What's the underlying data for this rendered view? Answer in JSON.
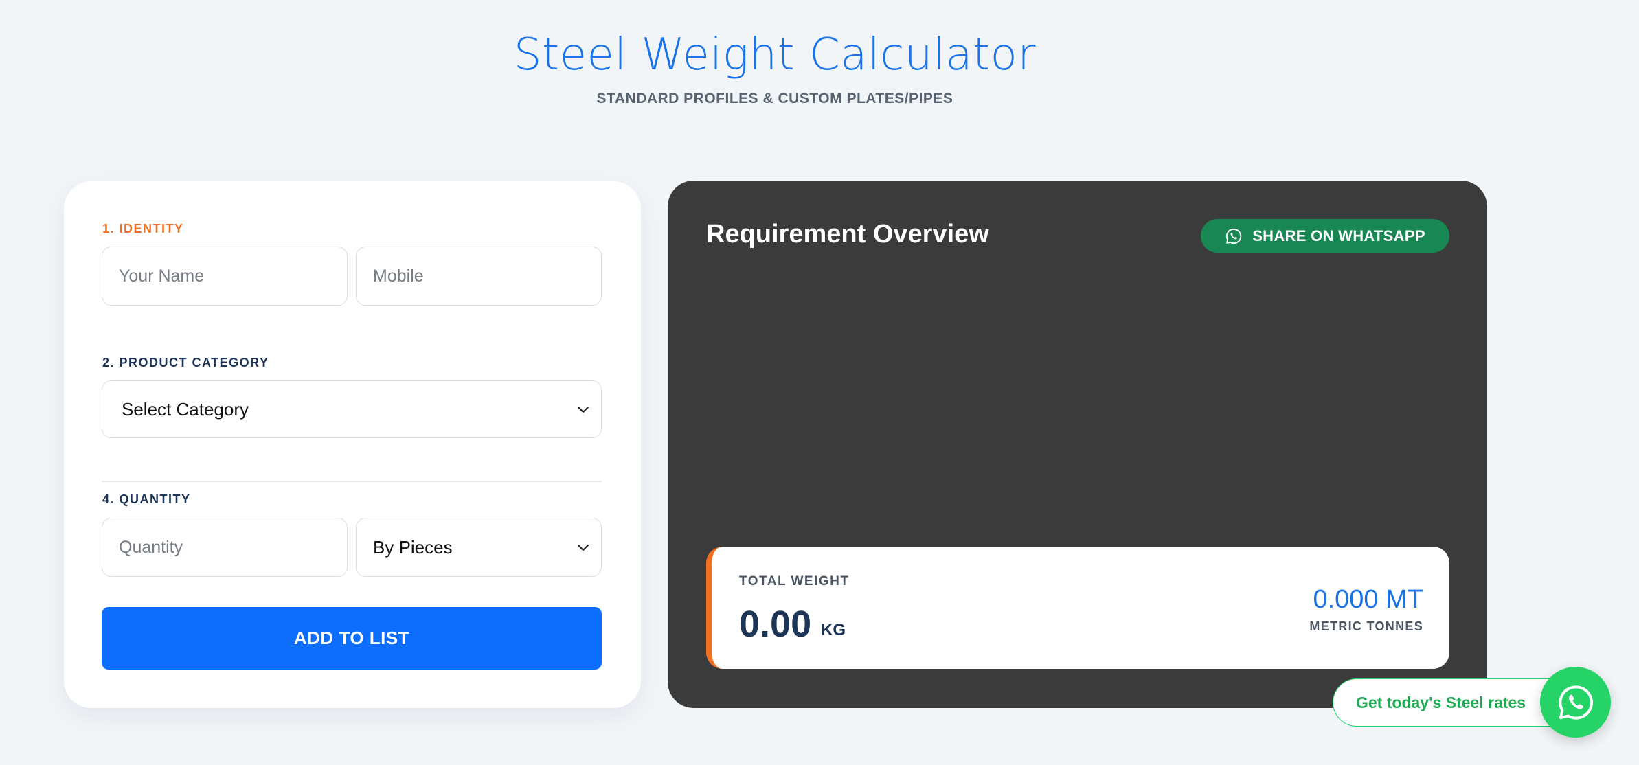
{
  "header": {
    "title": "Steel Weight Calculator",
    "subtitle": "STANDARD PROFILES & CUSTOM PLATES/PIPES"
  },
  "form": {
    "identity_label": "1. IDENTITY",
    "name_placeholder": "Your Name",
    "mobile_placeholder": "Mobile",
    "category_label": "2. PRODUCT CATEGORY",
    "category_selected": "Select Category",
    "quantity_label": "4. QUANTITY",
    "quantity_placeholder": "Quantity",
    "unit_selected": "By Pieces",
    "add_button": "ADD TO LIST"
  },
  "overview": {
    "title": "Requirement Overview",
    "share_button": "SHARE ON WHATSAPP",
    "total_weight_label": "TOTAL WEIGHT",
    "total_weight_value": "0.00",
    "total_weight_unit": "KG",
    "metric_value": "0.000 MT",
    "metric_label": "METRIC TONNES"
  },
  "floating": {
    "rates_text": "Get today's Steel rates",
    "fab_icon": "whatsapp-icon"
  },
  "colors": {
    "accent_blue": "#0d6efd",
    "accent_orange": "#f07020",
    "whatsapp_green": "#25d366",
    "share_green": "#198754",
    "dark_panel": "#3b3b3b"
  }
}
